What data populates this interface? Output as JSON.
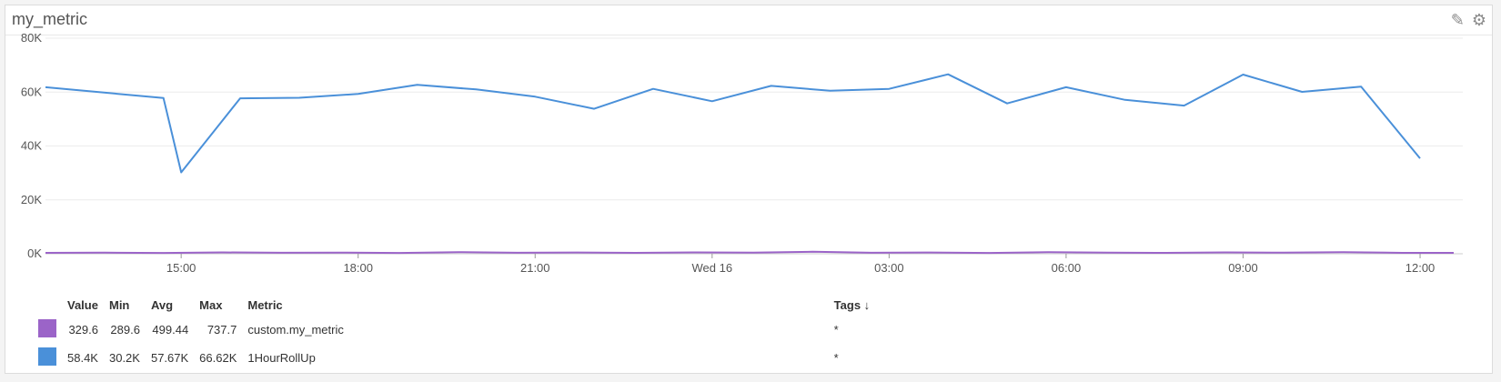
{
  "title": "my_metric",
  "icons": [
    "pencil-icon",
    "gear-icon"
  ],
  "chart_data": {
    "type": "line",
    "y_ticks": [
      "80K",
      "60K",
      "40K",
      "20K",
      "0K"
    ],
    "y_tick_values": [
      80000,
      60000,
      40000,
      20000,
      0
    ],
    "ylim": [
      0,
      80000
    ],
    "x_ticks": [
      "15:00",
      "18:00",
      "21:00",
      "Wed 16",
      "03:00",
      "06:00",
      "09:00",
      "12:00"
    ],
    "x_tick_hours": [
      15,
      18,
      21,
      24,
      27,
      30,
      33,
      36
    ],
    "xlim_hours": [
      12.7,
      36.57
    ],
    "grid": true,
    "series": [
      {
        "name": "custom.my_metric",
        "color": "#9b64c8",
        "x_hours": [
          12.7,
          13.7,
          14.7,
          15.7,
          16.7,
          17.7,
          18.7,
          19.7,
          20.7,
          21.7,
          22.7,
          23.7,
          24.7,
          25.7,
          26.7,
          27.7,
          28.7,
          29.7,
          30.7,
          31.7,
          32.7,
          33.7,
          34.7,
          35.7,
          36.57
        ],
        "values": [
          330,
          420,
          300,
          510,
          360,
          450,
          320,
          600,
          380,
          470,
          340,
          520,
          400,
          737,
          360,
          480,
          310,
          560,
          420,
          350,
          500,
          390,
          620,
          330,
          329
        ]
      },
      {
        "name": "1HourRollUp",
        "color": "#4a90d9",
        "x_hours": [
          12.7,
          14.7,
          15.0,
          16.0,
          17.0,
          18.0,
          19.0,
          20.0,
          21.0,
          22.0,
          23.0,
          24.0,
          25.0,
          26.0,
          27.0,
          28.0,
          29.0,
          30.0,
          31.0,
          32.0,
          33.0,
          34.0,
          35.0,
          36.0
        ],
        "values": [
          61800,
          57800,
          30200,
          57700,
          57900,
          59300,
          62700,
          61000,
          58300,
          53800,
          61200,
          56600,
          62300,
          60500,
          61200,
          66600,
          55800,
          61800,
          57100,
          55000,
          66500,
          60100,
          62000,
          35400
        ]
      }
    ],
    "legend": {
      "columns": [
        "Value",
        "Min",
        "Avg",
        "Max",
        "Metric",
        "Tags ↓"
      ],
      "rows": [
        {
          "color": "#9b64c8",
          "value": "329.6",
          "min": "289.6",
          "avg": "499.44",
          "max": "737.7",
          "metric": "custom.my_metric",
          "tags": "*"
        },
        {
          "color": "#4a90d9",
          "value": "58.4K",
          "min": "30.2K",
          "avg": "57.67K",
          "max": "66.62K",
          "metric": "1HourRollUp",
          "tags": "*"
        }
      ]
    }
  }
}
